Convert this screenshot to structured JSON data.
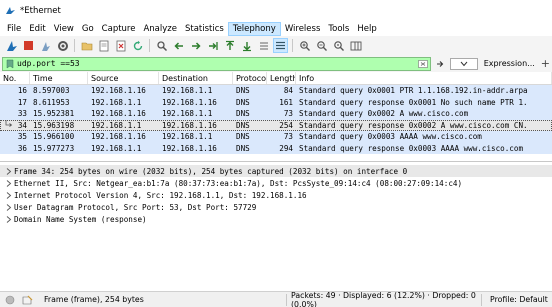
{
  "window": {
    "title": "*Ethernet"
  },
  "menu": [
    "File",
    "Edit",
    "View",
    "Go",
    "Capture",
    "Analyze",
    "Statistics",
    "Telephony",
    "Wireless",
    "Tools",
    "Help"
  ],
  "toolbar_icons": [
    "shark-fin-start-icon",
    "stop-icon",
    "restart-icon",
    "options-gear-icon",
    "open-folder-icon",
    "save-file-icon",
    "close-file-icon",
    "reload-icon",
    "find-magnifier-icon",
    "go-back-icon",
    "go-forward-icon",
    "go-to-packet-icon",
    "go-first-icon",
    "go-last-icon",
    "autoscroll-icon",
    "colorize-icon",
    "zoom-in-icon",
    "zoom-out-icon",
    "zoom-normal-icon",
    "resize-columns-icon"
  ],
  "filter": {
    "value": "udp.port ==53",
    "expression_label": "Expression...",
    "plus_label": "+"
  },
  "packet_list": {
    "columns": [
      "No.",
      "Time",
      "Source",
      "Destination",
      "Protocol",
      "Length",
      "Info"
    ],
    "rows": [
      {
        "no": "16",
        "time": "8.597003",
        "src": "192.168.1.16",
        "dst": "192.168.1.1",
        "proto": "DNS",
        "len": "84",
        "info": "Standard query 0x0001 PTR 1.1.168.192.in-addr.arpa"
      },
      {
        "no": "17",
        "time": "8.611953",
        "src": "192.168.1.1",
        "dst": "192.168.1.16",
        "proto": "DNS",
        "len": "161",
        "info": "Standard query response 0x0001 No such name PTR 1."
      },
      {
        "no": "33",
        "time": "15.952381",
        "src": "192.168.1.16",
        "dst": "192.168.1.1",
        "proto": "DNS",
        "len": "73",
        "info": "Standard query 0x0002 A www.cisco.com"
      },
      {
        "no": "34",
        "time": "15.963198",
        "src": "192.168.1.1",
        "dst": "192.168.1.16",
        "proto": "DNS",
        "len": "254",
        "info": "Standard query response 0x0002 A www.cisco.com CN."
      },
      {
        "no": "35",
        "time": "15.966100",
        "src": "192.168.1.16",
        "dst": "192.168.1.1",
        "proto": "DNS",
        "len": "73",
        "info": "Standard query 0x0003 AAAA www.cisco.com"
      },
      {
        "no": "36",
        "time": "15.977273",
        "src": "192.168.1.1",
        "dst": "192.168.1.16",
        "proto": "DNS",
        "len": "294",
        "info": "Standard query response 0x0003 AAAA www.cisco.com"
      }
    ],
    "selected_index": 3
  },
  "packet_details": [
    "Frame 34: 254 bytes on wire (2032 bits), 254 bytes captured (2032 bits) on interface 0",
    "Ethernet II, Src: Netgear_ea:b1:7a (80:37:73:ea:b1:7a), Dst: PcsSyste_09:14:c4 (08:00:27:09:14:c4)",
    "Internet Protocol Version 4, Src: 192.168.1.1, Dst: 192.168.1.16",
    "User Datagram Protocol, Src Port: 53, Dst Port: 57729",
    "Domain Name System (response)"
  ],
  "status": {
    "frame": "Frame (frame), 254 bytes",
    "packets": "Packets: 49 · Displayed: 6 (12.2%) · Dropped: 0 (0.0%)",
    "profile": "Profile: Default"
  },
  "colors": {
    "row_bg": "#dae8fc",
    "filter_bg": "#afffaf",
    "selected_bg": "#e8e8e8",
    "menu_active": "#cce8ff"
  }
}
